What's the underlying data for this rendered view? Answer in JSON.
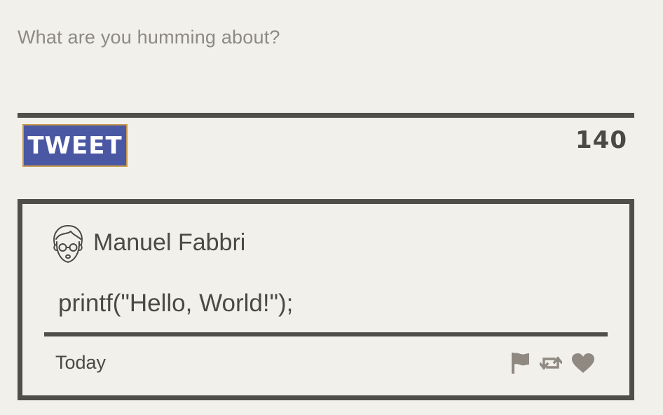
{
  "compose": {
    "placeholder": "What are you humming about?",
    "button_label": "TWEET",
    "char_count": "140"
  },
  "tweet": {
    "author": "Manuel Fabbri",
    "avatar_icon": "user-avatar-icon",
    "text": "printf(\"Hello, World!\");",
    "timestamp": "Today",
    "actions": [
      "flag-icon",
      "retweet-icon",
      "heart-icon"
    ]
  },
  "colors": {
    "background": "#f2f0eb",
    "accent": "#4a57a3",
    "button_border": "#c99a4e",
    "text": "#4a4945",
    "rule": "#4f4e49",
    "action_icons": "#8f8982"
  }
}
